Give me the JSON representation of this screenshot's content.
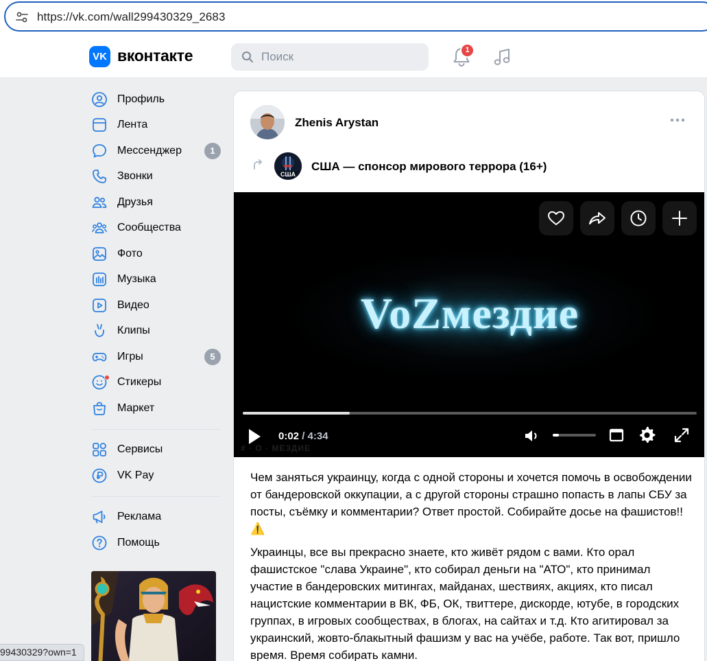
{
  "browser": {
    "url": "https://vk.com/wall299430329_2683",
    "status_url": "99430329?own=1"
  },
  "header": {
    "logo_text": "VK",
    "wordmark": "вконтакте",
    "search_placeholder": "Поиск",
    "notifications_count": "1"
  },
  "sidebar": {
    "items": [
      {
        "label": "Профиль",
        "icon": "profile-icon"
      },
      {
        "label": "Лента",
        "icon": "feed-icon"
      },
      {
        "label": "Мессенджер",
        "icon": "messenger-icon",
        "count": "1"
      },
      {
        "label": "Звонки",
        "icon": "phone-icon"
      },
      {
        "label": "Друзья",
        "icon": "friends-icon"
      },
      {
        "label": "Сообщества",
        "icon": "communities-icon"
      },
      {
        "label": "Фото",
        "icon": "photo-icon"
      },
      {
        "label": "Музыка",
        "icon": "music-icon"
      },
      {
        "label": "Видео",
        "icon": "video-icon"
      },
      {
        "label": "Клипы",
        "icon": "clips-icon"
      },
      {
        "label": "Игры",
        "icon": "games-icon",
        "count": "5"
      },
      {
        "label": "Стикеры",
        "icon": "stickers-icon"
      },
      {
        "label": "Маркет",
        "icon": "market-icon"
      }
    ],
    "services": [
      {
        "label": "Сервисы",
        "icon": "services-icon"
      },
      {
        "label": "VK Pay",
        "icon": "vkpay-icon"
      }
    ],
    "footer": [
      {
        "label": "Реклама",
        "icon": "ads-icon"
      },
      {
        "label": "Помощь",
        "icon": "help-icon"
      }
    ]
  },
  "post": {
    "author": "Zhenis Arystan",
    "repost_source": "США — спонсор мирового террора (16+)",
    "group_avatar_text": "США",
    "video": {
      "title": "VoZмездие",
      "caption": "# · О · МЕЗДИЕ",
      "current_time": "0:02",
      "separator": " / ",
      "duration": "4:34",
      "progress_fraction": 0.235,
      "volume_fraction": 0.15
    },
    "paragraphs": [
      "Чем заняться украинцу, когда с одной стороны и хочется помочь в освобождении от бандеровской оккупации, а с другой стороны страшно попасть в лапы СБУ за посты, съёмку и комментарии? Ответ простой. Собирайте досье на фашистов!! ⚠️",
      "Украинцы, все вы прекрасно знаете, кто живёт рядом с вами. Кто орал фашистское \"слава Украине\", кто собирал деньги на \"АТО\", кто принимал участие в бандеровских митингах, майданах, шествиях, акциях, кто писал нацистские комментарии в ВК, ФБ, ОК, твиттере, дискорде, ютубе, в городских группах, в игровых сообществах, в блогах, на сайтах и т.д. Кто агитировал за украинский, жовто-блакытный фашизм у вас на учёбе, работе. Так вот, пришло время. Время собирать камни."
    ]
  },
  "colors": {
    "vk_blue": "#0077ff",
    "badge_red": "#e64646",
    "counter_gray": "#99a2ad",
    "page_bg": "#edeef0"
  }
}
